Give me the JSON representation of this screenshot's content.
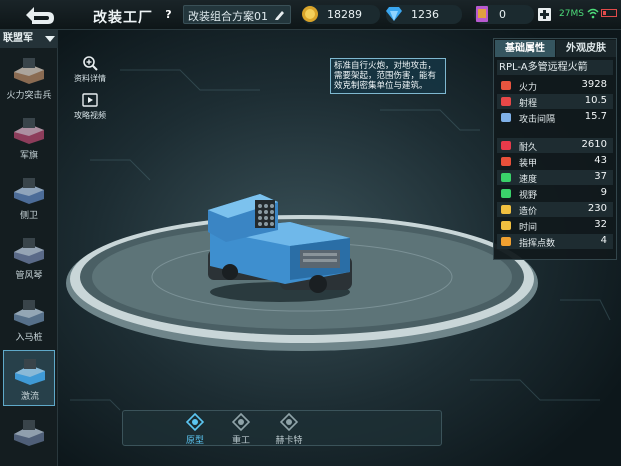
{
  "header": {
    "title": "改装工厂",
    "help": "?",
    "scheme_name": "改装组合方案01",
    "gold": "18289",
    "diamonds": "1236",
    "cards": "0",
    "ping": "27MS"
  },
  "sidebar": {
    "faction": "联盟军",
    "items": [
      {
        "label": "火力突击兵",
        "color": "#8a6b52"
      },
      {
        "label": "军旗",
        "color": "#8d3d5b"
      },
      {
        "label": "侧卫",
        "color": "#4c6c98"
      },
      {
        "label": "管风琴",
        "color": "#5a6a88"
      },
      {
        "label": "入马桩",
        "color": "#56708a"
      },
      {
        "label": "激流",
        "color": "#3f9ad6"
      },
      {
        "label": "",
        "color": "#4f5f78"
      }
    ]
  },
  "links": {
    "detail": "资料详情",
    "guide": "攻略视频"
  },
  "description": "标准自行火炮，对地攻击，需要架起，范围伤害，能有效克制密集单位与建筑。",
  "panel": {
    "tab_basic": "基础属性",
    "tab_skin": "外观皮肤",
    "unit_name": "RPL-A多管远程火箭",
    "stats": [
      {
        "label": "火力",
        "value": "3928",
        "icon": "firepower-icon",
        "color": "#e8553f"
      },
      {
        "label": "射程",
        "value": "10.5",
        "icon": "range-icon",
        "color": "#e84848"
      },
      {
        "label": "攻击间隔",
        "value": "15.7",
        "icon": "hourglass-icon",
        "color": "#7fb0e8"
      },
      {
        "label": "耐久",
        "value": "2610",
        "icon": "heart-icon",
        "color": "#e83a4a"
      },
      {
        "label": "装甲",
        "value": "43",
        "icon": "armor-icon",
        "color": "#e8503a"
      },
      {
        "label": "速度",
        "value": "37",
        "icon": "speed-icon",
        "color": "#3ad26a"
      },
      {
        "label": "视野",
        "value": "9",
        "icon": "vision-icon",
        "color": "#3ad26a"
      },
      {
        "label": "造价",
        "value": "230",
        "icon": "cost-icon",
        "color": "#f0c040"
      },
      {
        "label": "时间",
        "value": "32",
        "icon": "time-icon",
        "color": "#f0c040"
      },
      {
        "label": "指挥点数",
        "value": "4",
        "icon": "command-icon",
        "color": "#f0a030"
      }
    ]
  },
  "modes": [
    {
      "label": "原型",
      "selected": true
    },
    {
      "label": "重工",
      "selected": false
    },
    {
      "label": "赫卡特",
      "selected": false
    }
  ]
}
